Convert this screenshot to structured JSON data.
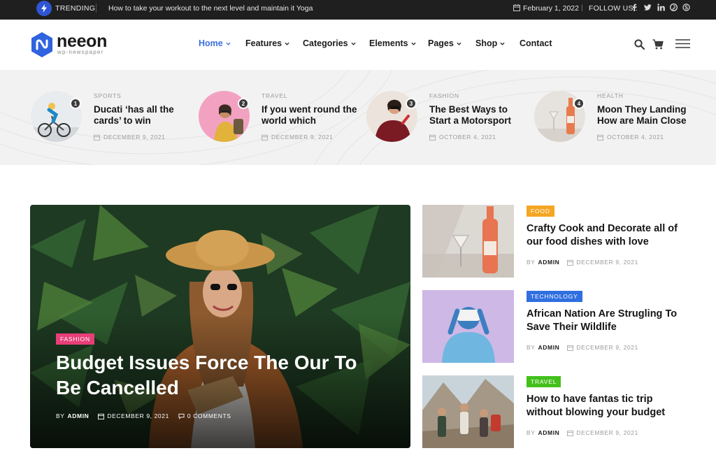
{
  "topbar": {
    "trending_label": "TRENDING",
    "trending_text": "How to take your workout to the next level and maintain it Yoga",
    "date": "February 1, 2022",
    "separator": "|",
    "follow_label": "FOLLOW US :",
    "social_icons": [
      "facebook-icon",
      "twitter-icon",
      "linkedin-icon",
      "pinterest-icon",
      "skype-icon"
    ]
  },
  "header": {
    "logo_name": "neeon",
    "logo_tagline": "wp-newspaper",
    "nav": [
      {
        "label": "Home",
        "active": true,
        "dropdown": true
      },
      {
        "label": "Features",
        "active": false,
        "dropdown": true
      },
      {
        "label": "Categories",
        "active": false,
        "dropdown": true
      },
      {
        "label": "Elements",
        "active": false,
        "dropdown": true
      },
      {
        "label": "Pages",
        "active": false,
        "dropdown": true
      },
      {
        "label": "Shop",
        "active": false,
        "dropdown": true
      },
      {
        "label": "Contact",
        "active": false,
        "dropdown": false
      }
    ],
    "icons": [
      "search-icon",
      "cart-icon",
      "menu-icon"
    ]
  },
  "trending_posts": [
    {
      "num": "1",
      "category": "SPORTS",
      "title": "Ducati ‘has all the cards’ to win",
      "date": "DECEMBER 9, 2021"
    },
    {
      "num": "2",
      "category": "TRAVEL",
      "title": "If you went round the world which",
      "date": "DECEMBER 9, 2021"
    },
    {
      "num": "3",
      "category": "FASHION",
      "title": "The Best Ways to Start a Motorsport",
      "date": "OCTOBER 4, 2021"
    },
    {
      "num": "4",
      "category": "HEALTH",
      "title": "Moon They Landing How are Main Close",
      "date": "OCTOBER 4, 2021"
    }
  ],
  "hero": {
    "category": "FASHION",
    "title": "Budget Issues Force The Our To Be Cancelled",
    "by": "BY",
    "author": "ADMIN",
    "date": "DECEMBER 9, 2021",
    "comments": "0 COMMENTS"
  },
  "side_posts": [
    {
      "category": "FOOD",
      "badge_color": "#f5a623",
      "title": "Crafty Cook and Decorate all of our food dishes with love",
      "by": "BY",
      "author": "ADMIN",
      "date": "DECEMBER 9, 2021"
    },
    {
      "category": "TECHNOLOGY",
      "badge_color": "#2f6fe0",
      "title": "African Nation Are Strugling To Save Their Wildlife",
      "by": "BY",
      "author": "ADMIN",
      "date": "DECEMBER 9, 2021"
    },
    {
      "category": "TRAVEL",
      "badge_color": "#43c01a",
      "title": "How to have fantas tic trip without blowing your budget",
      "by": "BY",
      "author": "ADMIN",
      "date": "DECEMBER 9, 2021"
    }
  ],
  "colors": {
    "accent": "#3a70e0",
    "topbar_bg": "#1f1f1f",
    "fashion_badge": "#e83e78"
  }
}
